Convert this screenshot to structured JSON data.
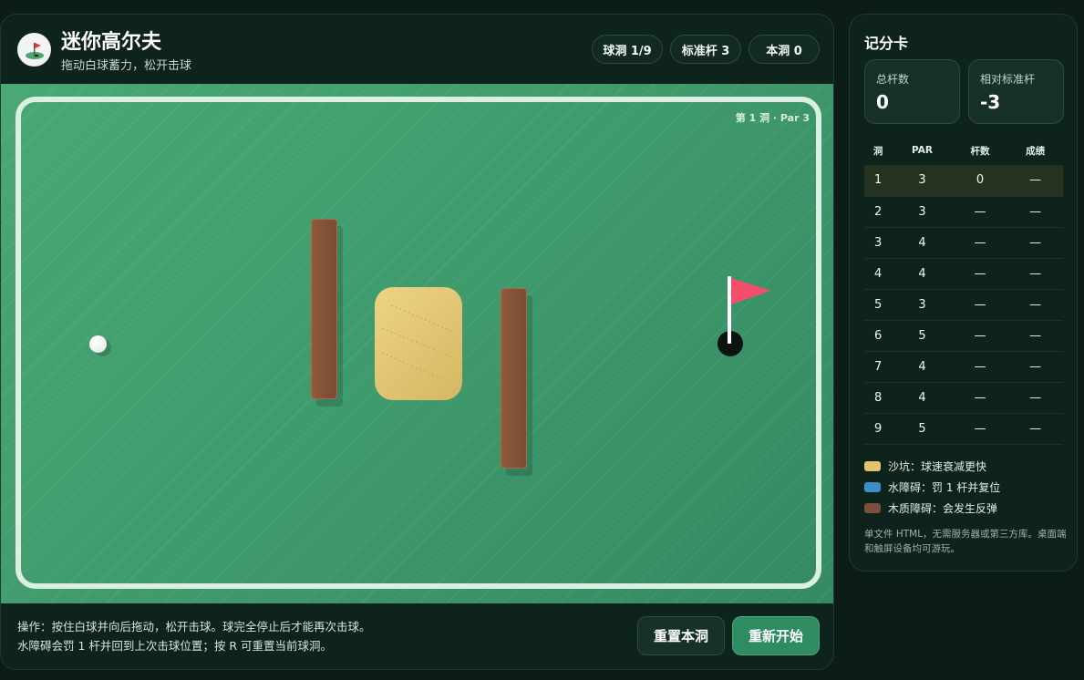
{
  "header": {
    "title": "迷你高尔夫",
    "subtitle": "拖动白球蓄力，松开击球",
    "pills": {
      "hole": "球洞 1/9",
      "par": "标准杆 3",
      "strokes": "本洞 0"
    }
  },
  "course": {
    "hole_label": "第 1 洞 · Par 3"
  },
  "footer": {
    "instructions_line1": "操作：按住白球并向后拖动，松开击球。球完全停止后才能再次击球。",
    "instructions_line2": "水障碍会罚 1 杆并回到上次击球位置；按 R 可重置当前球洞。",
    "reset_hole_label": "重置本洞",
    "restart_label": "重新开始"
  },
  "scorecard": {
    "title": "记分卡",
    "total_strokes_label": "总杆数",
    "total_strokes_value": "0",
    "relative_par_label": "相对标准杆",
    "relative_par_value": "-3",
    "columns": [
      "洞",
      "PAR",
      "杆数",
      "成绩"
    ],
    "rows": [
      {
        "hole": "1",
        "par": "3",
        "strokes": "0",
        "result": "—"
      },
      {
        "hole": "2",
        "par": "3",
        "strokes": "—",
        "result": "—"
      },
      {
        "hole": "3",
        "par": "4",
        "strokes": "—",
        "result": "—"
      },
      {
        "hole": "4",
        "par": "4",
        "strokes": "—",
        "result": "—"
      },
      {
        "hole": "5",
        "par": "3",
        "strokes": "—",
        "result": "—"
      },
      {
        "hole": "6",
        "par": "5",
        "strokes": "—",
        "result": "—"
      },
      {
        "hole": "7",
        "par": "4",
        "strokes": "—",
        "result": "—"
      },
      {
        "hole": "8",
        "par": "4",
        "strokes": "—",
        "result": "—"
      },
      {
        "hole": "9",
        "par": "5",
        "strokes": "—",
        "result": "—"
      }
    ],
    "legend": [
      {
        "label": "沙坑：球速衰减更快",
        "color": "#e3c46e"
      },
      {
        "label": "水障碍：罚 1 杆并复位",
        "color": "#3b8fc6"
      },
      {
        "label": "木质障碍：会发生反弹",
        "color": "#7a4e38"
      }
    ],
    "note": "单文件 HTML，无需服务器或第三方库。桌面端和触屏设备均可游玩。"
  },
  "colors": {
    "accent": "#2e8b62",
    "flag": "#f2506a",
    "fairway": "#3f9a6c"
  }
}
